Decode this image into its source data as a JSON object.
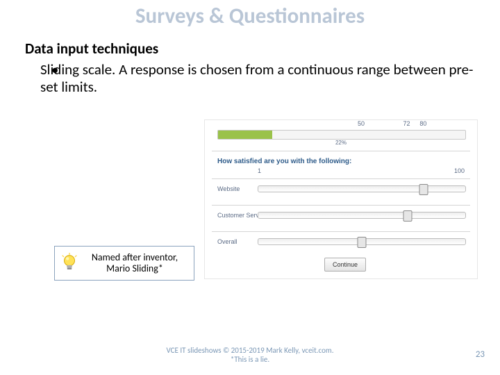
{
  "title": "Surveys & Questionnaires",
  "subhead": "Data input techniques",
  "bullet": "Sliding scale. A response is chosen from a continuous range between pre-set limits.",
  "survey": {
    "progress_pct": 22,
    "progress_label": "22%",
    "question": "How satisfied are you with the following:",
    "min_label": "1",
    "max_label": "100",
    "rows": [
      {
        "label": "Website",
        "value": 80
      },
      {
        "label": "Customer Service",
        "value": 72
      },
      {
        "label": "Overall",
        "value": 50
      }
    ],
    "continue": "Continue"
  },
  "callout": {
    "line1": "Named after inventor,",
    "line2": "Mario Sliding*"
  },
  "footer": {
    "line1": "VCE IT slideshows © 2015-2019 Mark Kelly, vceit.com.",
    "line2": "*This is a lie."
  },
  "page_number": "23"
}
